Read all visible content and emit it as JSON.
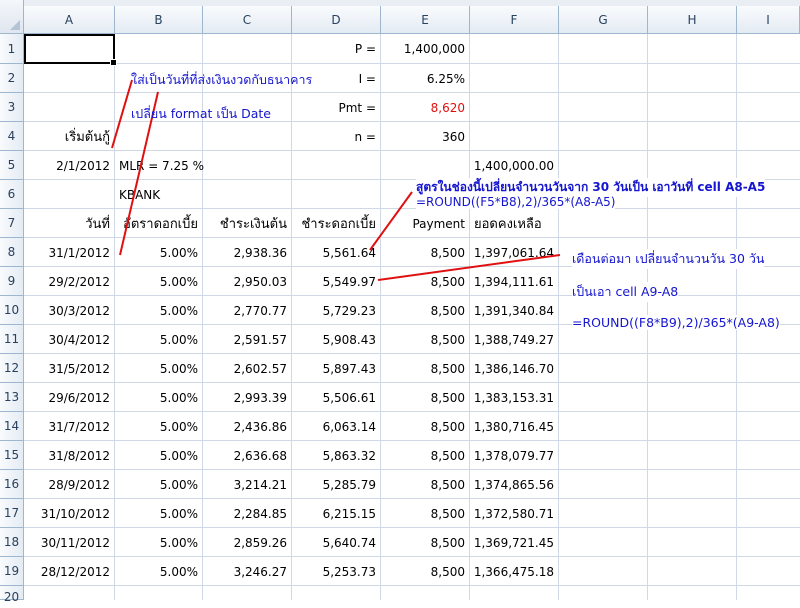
{
  "columns": [
    "A",
    "B",
    "C",
    "D",
    "E",
    "F",
    "G",
    "H",
    "I"
  ],
  "rows": [
    "1",
    "2",
    "3",
    "4",
    "5",
    "6",
    "7",
    "8",
    "9",
    "10",
    "11",
    "12",
    "13",
    "14",
    "15",
    "16",
    "17",
    "18",
    "19",
    "20"
  ],
  "params": {
    "p_label": "P =",
    "p_value": "1,400,000",
    "i_label": "I =",
    "i_value": "6.25%",
    "pmt_label": "Pmt =",
    "pmt_value": "8,620",
    "n_label": "n =",
    "n_value": "360"
  },
  "row4_label": "เริ่มต้นกู้",
  "row5": {
    "date": "2/1/2012",
    "mlr": "MLR = 7.25 %",
    "balance": "1,400,000.00"
  },
  "row6_bank": "KBANK",
  "headers": {
    "date": "วันที่",
    "rate": "อัตราดอกเบี้ย",
    "principal": "ชำระเงินต้น",
    "interest": "ชำระดอกเบี้ย",
    "payment": "Payment",
    "balance": "ยอดคงเหลือ"
  },
  "table": [
    [
      "31/1/2012",
      "5.00%",
      "2,938.36",
      "5,561.64",
      "8,500",
      "1,397,061.64"
    ],
    [
      "29/2/2012",
      "5.00%",
      "2,950.03",
      "5,549.97",
      "8,500",
      "1,394,111.61"
    ],
    [
      "30/3/2012",
      "5.00%",
      "2,770.77",
      "5,729.23",
      "8,500",
      "1,391,340.84"
    ],
    [
      "30/4/2012",
      "5.00%",
      "2,591.57",
      "5,908.43",
      "8,500",
      "1,388,749.27"
    ],
    [
      "31/5/2012",
      "5.00%",
      "2,602.57",
      "5,897.43",
      "8,500",
      "1,386,146.70"
    ],
    [
      "29/6/2012",
      "5.00%",
      "2,993.39",
      "5,506.61",
      "8,500",
      "1,383,153.31"
    ],
    [
      "31/7/2012",
      "5.00%",
      "2,436.86",
      "6,063.14",
      "8,500",
      "1,380,716.45"
    ],
    [
      "31/8/2012",
      "5.00%",
      "2,636.68",
      "5,863.32",
      "8,500",
      "1,378,079.77"
    ],
    [
      "28/9/2012",
      "5.00%",
      "3,214.21",
      "5,285.79",
      "8,500",
      "1,374,865.56"
    ],
    [
      "31/10/2012",
      "5.00%",
      "2,284.85",
      "6,215.15",
      "8,500",
      "1,372,580.71"
    ],
    [
      "30/11/2012",
      "5.00%",
      "2,859.26",
      "5,640.74",
      "8,500",
      "1,369,721.45"
    ],
    [
      "28/12/2012",
      "5.00%",
      "3,246.27",
      "5,253.73",
      "8,500",
      "1,366,475.18"
    ]
  ],
  "notes": {
    "n1": "ใส่เป็นวันที่ที่ส่งเงินงวดกับธนาคาร",
    "n2": "เปลี่ยน format เป็น Date",
    "n3a": "สูตรในช่องนี้เปลี่ยนจำนวนวันจาก 30 วันเป็น เอาวันที่ cell A8-A5",
    "n3b": "=ROUND((F5*B8),2)/365*(A8-A5)",
    "n4a": "เดือนต่อมา เปลี่ยนจำนวนวัน 30 วัน",
    "n4b": "เป็นเอา cell A9-A8",
    "n4c": "=ROUND((F8*B9),2)/365*(A9-A8)"
  },
  "colors": {
    "grid": "#d0d7e5",
    "header_text": "#27415f",
    "note": "#1515d0",
    "pmt": "#e01010",
    "arrow": "#e01010"
  }
}
